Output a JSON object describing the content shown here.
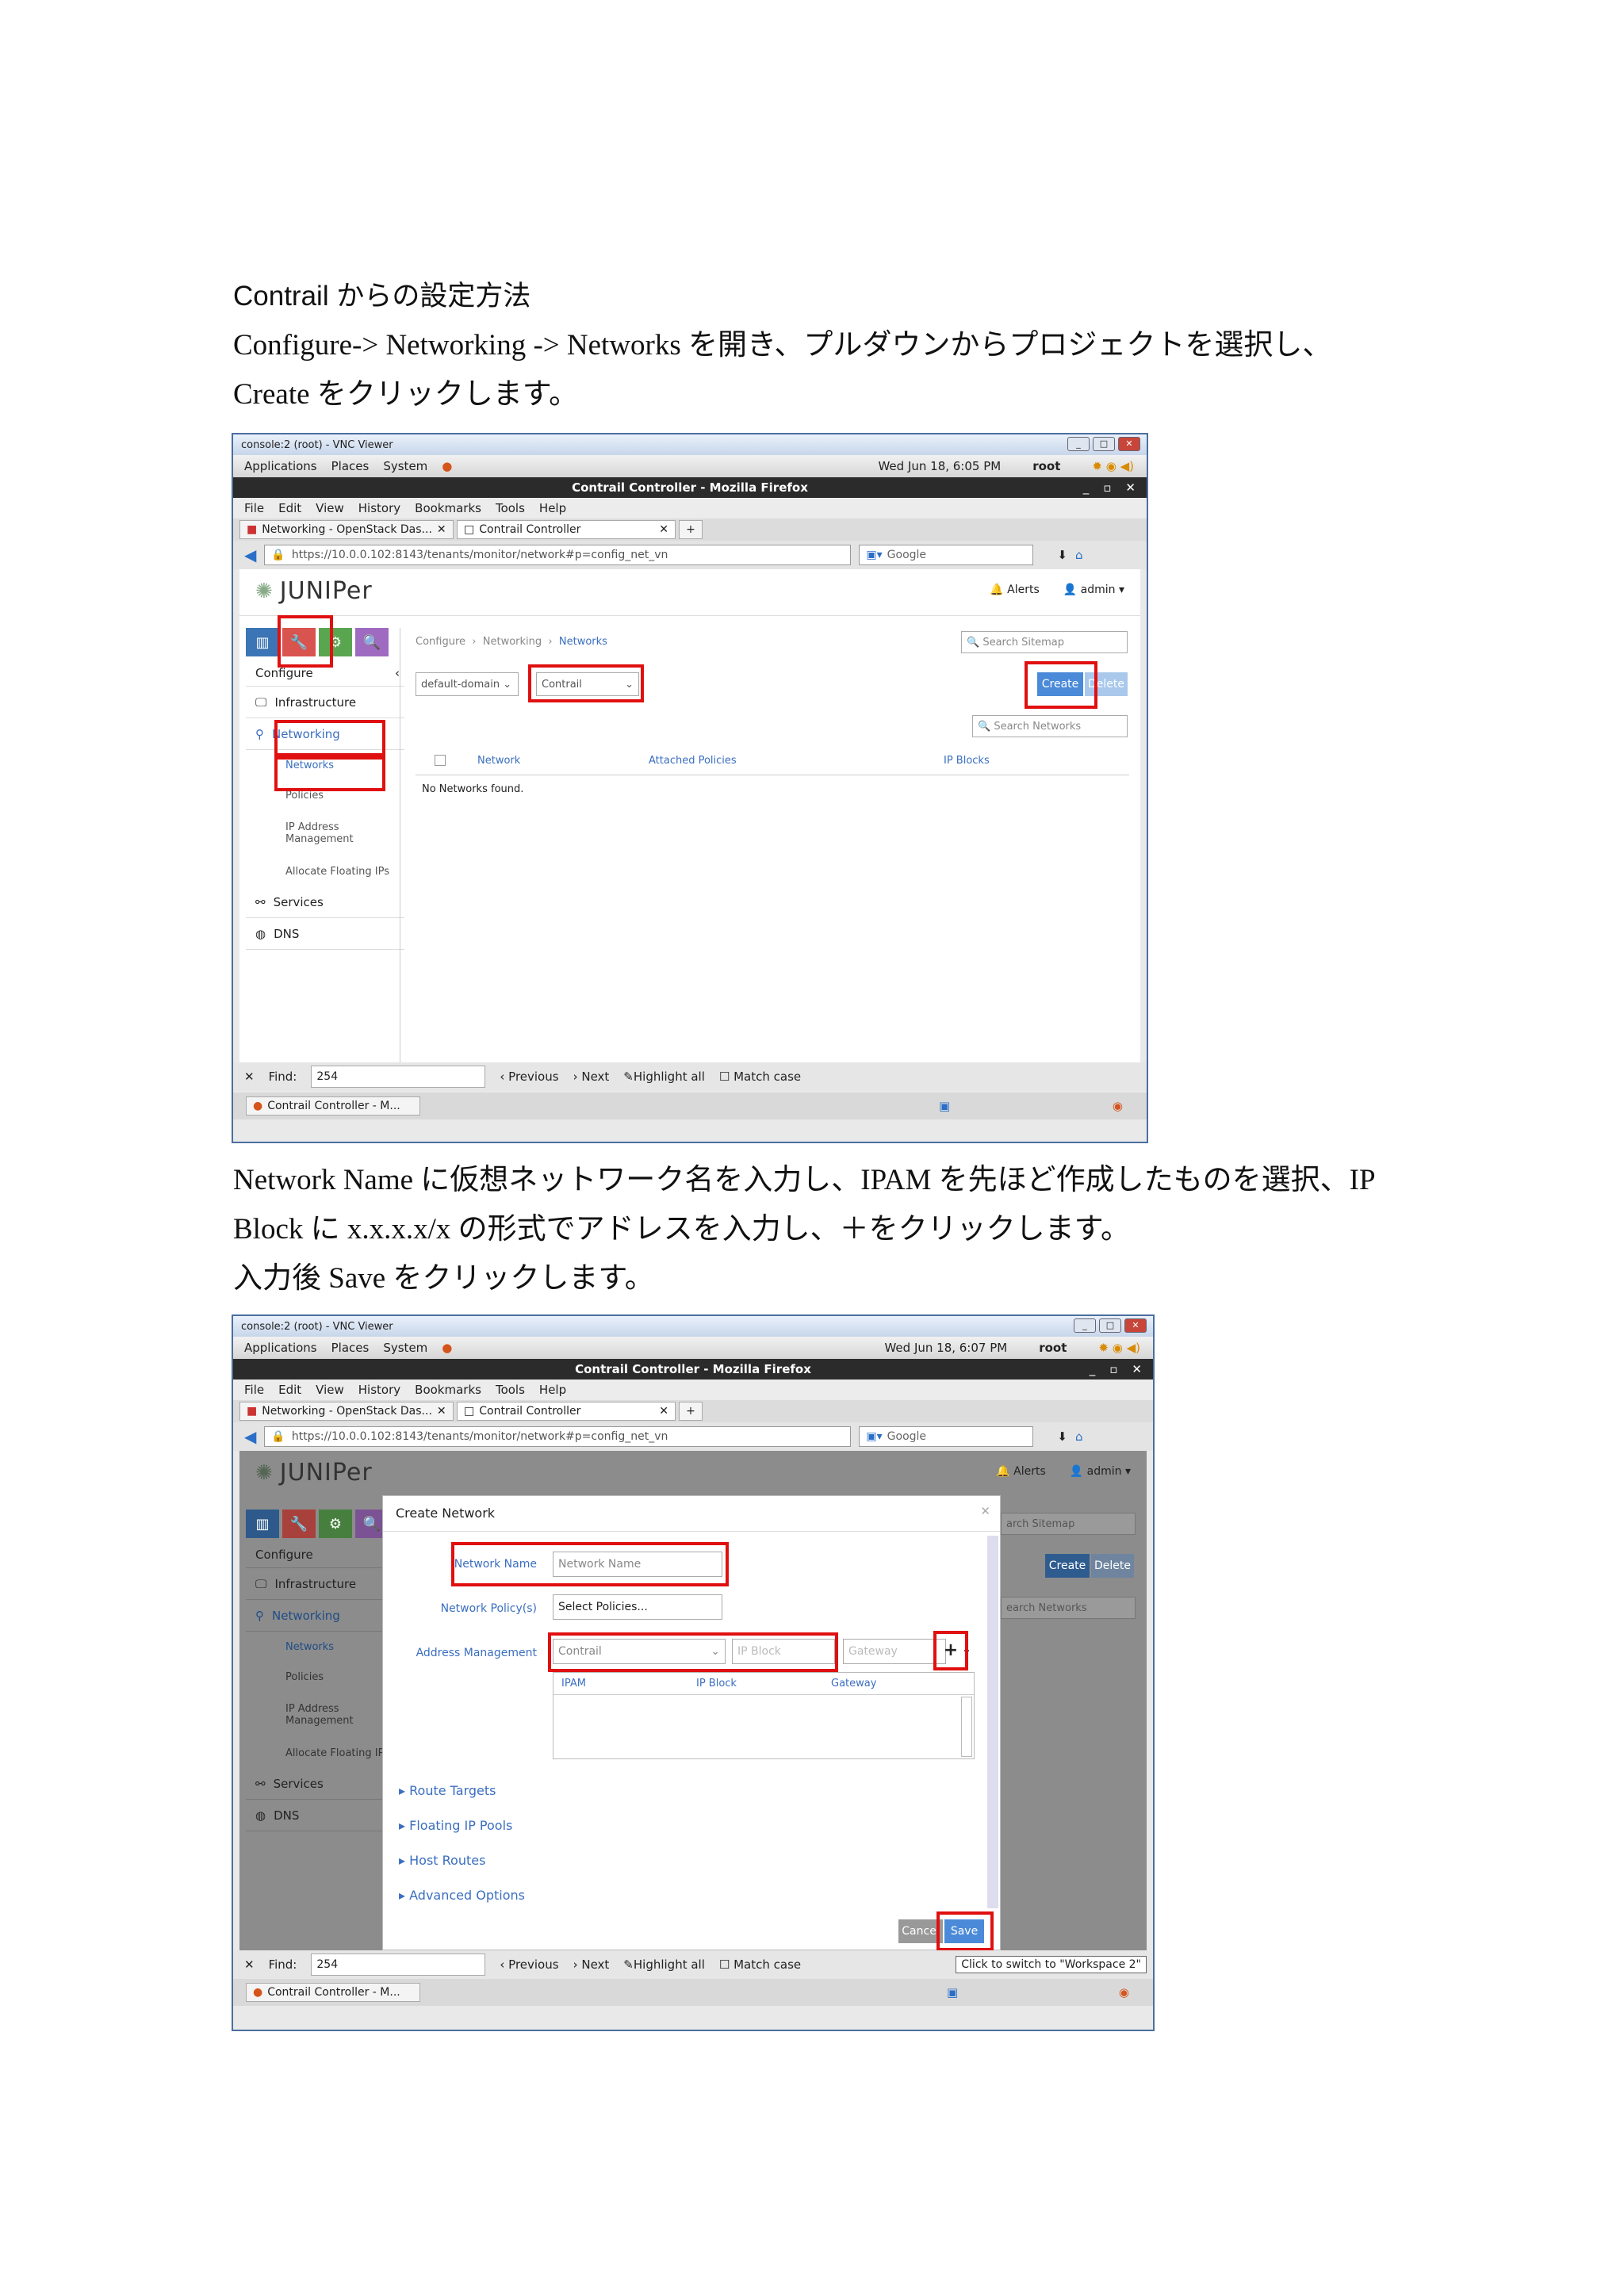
{
  "doc": {
    "heading": "Contrail からの設定方法",
    "para1": [
      "Configure-> Networking -> Networks を開き、プルダウンからプロジェクトを選択し、",
      "Create をクリックします。"
    ],
    "para2": [
      "Network Name に仮想ネットワーク名を入力し、IPAM を先ほど作成したものを選択、IP",
      "Block に x.x.x.x/x の形式でアドレスを入力し、＋をクリックします。",
      "入力後 Save をクリックします。"
    ]
  },
  "common": {
    "vnc_title": "console:2 (root) - VNC Viewer",
    "gnome_menu": [
      "Applications",
      "Places",
      "System"
    ],
    "user": "root",
    "ff_title": "Contrail Controller - Mozilla Firefox",
    "menus": [
      "File",
      "Edit",
      "View",
      "History",
      "Bookmarks",
      "Tools",
      "Help"
    ],
    "tabs": [
      "Networking - OpenStack Das...",
      "Contrail Controller"
    ],
    "url": "https://10.0.0.102:8143/tenants/monitor/network#p=config_net_vn",
    "search_engine": "Google",
    "brand": "JUNIPer",
    "alerts": "Alerts",
    "admin": "admin",
    "find_label": "Find:",
    "find_value": "254",
    "find_prev": "Previous",
    "find_next": "Next",
    "find_highlight": "Highlight all",
    "find_match": "Match case",
    "taskbar_item": "Contrail Controller - M...",
    "sidebar": {
      "configure": "Configure",
      "infrastructure": "Infrastructure",
      "networking": "Networking",
      "subs": [
        "Networks",
        "Policies",
        "IP Address Management",
        "Allocate Floating IPs"
      ],
      "services": "Services",
      "dns": "DNS"
    }
  },
  "shot1": {
    "clock": "Wed Jun 18,  6:05 PM",
    "breadcrumb": [
      "Configure",
      "Networking",
      "Networks"
    ],
    "search_sitemap": "Search Sitemap",
    "domain_select": "default-domain",
    "project_select": "Contrail",
    "create": "Create",
    "delete": "Delete",
    "search_networks": "Search Networks",
    "columns": [
      "Network",
      "Attached Policies",
      "IP Blocks"
    ],
    "empty": "No Networks found."
  },
  "shot2": {
    "clock": "Wed Jun 18,  6:07 PM",
    "modal_title": "Create Network",
    "network_name_label": "Network Name",
    "network_name_ph": "Network Name",
    "policy_label": "Network Policy(s)",
    "policy_value": "Select Policies...",
    "addr_label": "Address Management",
    "ipam_value": "Contrail",
    "ipblock_ph": "IP Block",
    "gateway_ph": "Gateway",
    "plus": "+",
    "minus": "-",
    "ipam_cols": [
      "IPAM",
      "IP Block",
      "Gateway"
    ],
    "sections": [
      "Route Targets",
      "Floating IP Pools",
      "Host Routes",
      "Advanced Options"
    ],
    "cancel": "Cancel",
    "save": "Save",
    "tooltip": "Click to switch to \"Workspace 2\"",
    "bg_sitemap": "arch Sitemap",
    "bg_networks": "earch Networks",
    "bg_create": "Create",
    "bg_delete": "Delete"
  }
}
